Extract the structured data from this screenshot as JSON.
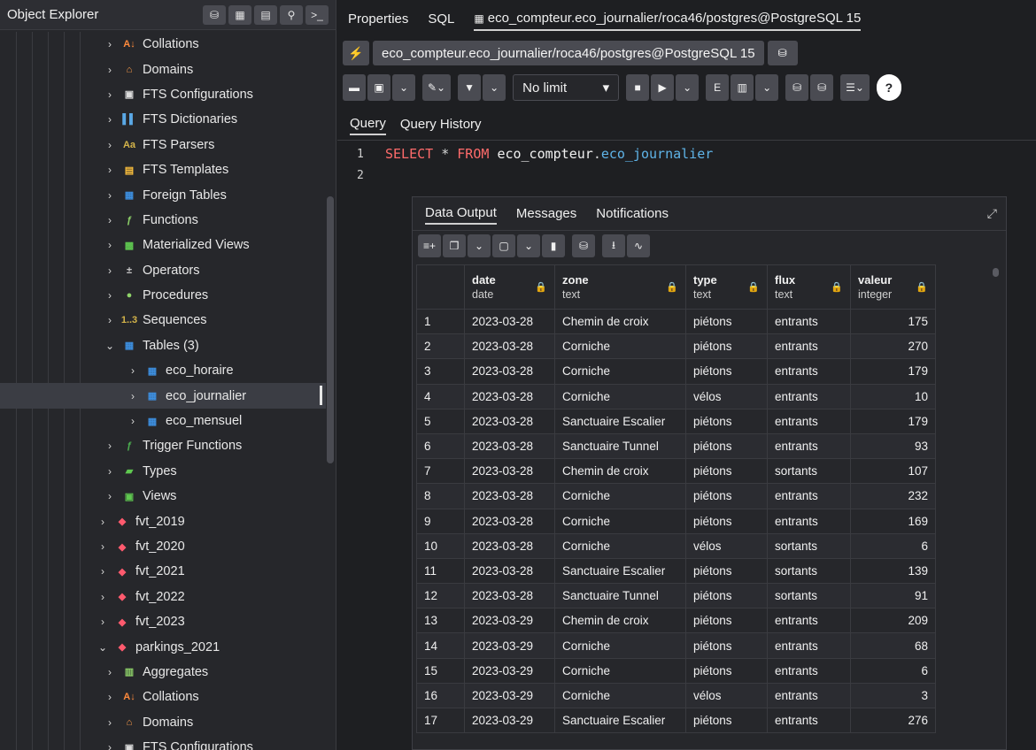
{
  "left_panel": {
    "title": "Object Explorer",
    "header_icons": [
      "database-icon",
      "table-grid-icon",
      "table-view-icon",
      "search-icon",
      "terminal-icon"
    ],
    "tree": [
      {
        "label": "Collations",
        "icon": "collations-icon",
        "indent": 3,
        "chev": "›"
      },
      {
        "label": "Domains",
        "icon": "domains-icon",
        "indent": 3,
        "chev": "›"
      },
      {
        "label": "FTS Configurations",
        "icon": "fts-config-icon",
        "indent": 3,
        "chev": "›"
      },
      {
        "label": "FTS Dictionaries",
        "icon": "fts-dict-icon",
        "indent": 3,
        "chev": "›"
      },
      {
        "label": "FTS Parsers",
        "icon": "fts-parser-icon",
        "indent": 3,
        "chev": "›"
      },
      {
        "label": "FTS Templates",
        "icon": "fts-template-icon",
        "indent": 3,
        "chev": "›"
      },
      {
        "label": "Foreign Tables",
        "icon": "foreign-table-icon",
        "indent": 3,
        "chev": "›"
      },
      {
        "label": "Functions",
        "icon": "function-icon",
        "indent": 3,
        "chev": "›"
      },
      {
        "label": "Materialized Views",
        "icon": "mview-icon",
        "indent": 3,
        "chev": "›"
      },
      {
        "label": "Operators",
        "icon": "operator-icon",
        "indent": 3,
        "chev": "›"
      },
      {
        "label": "Procedures",
        "icon": "procedure-icon",
        "indent": 3,
        "chev": "›"
      },
      {
        "label": "Sequences",
        "icon": "sequence-icon",
        "indent": 3,
        "chev": "›"
      },
      {
        "label": "Tables (3)",
        "icon": "tables-icon",
        "indent": 3,
        "chev": "⌄"
      },
      {
        "label": "eco_horaire",
        "icon": "table-icon",
        "indent": 4,
        "chev": "›"
      },
      {
        "label": "eco_journalier",
        "icon": "table-icon",
        "indent": 4,
        "chev": "›",
        "selected": true
      },
      {
        "label": "eco_mensuel",
        "icon": "table-icon",
        "indent": 4,
        "chev": "›"
      },
      {
        "label": "Trigger Functions",
        "icon": "trigger-function-icon",
        "indent": 3,
        "chev": "›"
      },
      {
        "label": "Types",
        "icon": "type-icon",
        "indent": 3,
        "chev": "›"
      },
      {
        "label": "Views",
        "icon": "view-icon",
        "indent": 3,
        "chev": "›"
      },
      {
        "label": "fvt_2019",
        "icon": "schema-icon",
        "indent": 2,
        "chev": "›"
      },
      {
        "label": "fvt_2020",
        "icon": "schema-icon",
        "indent": 2,
        "chev": "›"
      },
      {
        "label": "fvt_2021",
        "icon": "schema-icon",
        "indent": 2,
        "chev": "›"
      },
      {
        "label": "fvt_2022",
        "icon": "schema-icon",
        "indent": 2,
        "chev": "›"
      },
      {
        "label": "fvt_2023",
        "icon": "schema-icon",
        "indent": 2,
        "chev": "›"
      },
      {
        "label": "parkings_2021",
        "icon": "schema-icon",
        "indent": 2,
        "chev": "⌄"
      },
      {
        "label": "Aggregates",
        "icon": "aggregate-icon",
        "indent": 3,
        "chev": "›"
      },
      {
        "label": "Collations",
        "icon": "collations-icon",
        "indent": 3,
        "chev": "›"
      },
      {
        "label": "Domains",
        "icon": "domains-icon",
        "indent": 3,
        "chev": "›"
      },
      {
        "label": "FTS Configurations",
        "icon": "fts-config-icon",
        "indent": 3,
        "chev": "›"
      }
    ]
  },
  "tabs": [
    "Properties",
    "SQL",
    "eco_compteur.eco_journalier/roca46/postgres@PostgreSQL 15"
  ],
  "connection": "eco_compteur.eco_journalier/roca46/postgres@PostgreSQL 15",
  "toolbar": {
    "limit": "No limit"
  },
  "query_tabs": [
    "Query",
    "Query History"
  ],
  "editor": {
    "line_numbers": [
      "1",
      "2"
    ],
    "kw_select": "SELECT",
    "star": "*",
    "kw_from": "FROM",
    "schema": "eco_compteur",
    "dot": ".",
    "table": "eco_journalier"
  },
  "results": {
    "tabs": [
      "Data Output",
      "Messages",
      "Notifications"
    ],
    "columns": [
      {
        "name": "date",
        "type": "date"
      },
      {
        "name": "zone",
        "type": "text"
      },
      {
        "name": "type",
        "type": "text"
      },
      {
        "name": "flux",
        "type": "text"
      },
      {
        "name": "valeur",
        "type": "integer"
      }
    ],
    "rows": [
      [
        "1",
        "2023-03-28",
        "Chemin de croix",
        "piétons",
        "entrants",
        "175"
      ],
      [
        "2",
        "2023-03-28",
        "Corniche",
        "piétons",
        "entrants",
        "270"
      ],
      [
        "3",
        "2023-03-28",
        "Corniche",
        "piétons",
        "entrants",
        "179"
      ],
      [
        "4",
        "2023-03-28",
        "Corniche",
        "vélos",
        "entrants",
        "10"
      ],
      [
        "5",
        "2023-03-28",
        "Sanctuaire Escalier",
        "piétons",
        "entrants",
        "179"
      ],
      [
        "6",
        "2023-03-28",
        "Sanctuaire Tunnel",
        "piétons",
        "entrants",
        "93"
      ],
      [
        "7",
        "2023-03-28",
        "Chemin de croix",
        "piétons",
        "sortants",
        "107"
      ],
      [
        "8",
        "2023-03-28",
        "Corniche",
        "piétons",
        "entrants",
        "232"
      ],
      [
        "9",
        "2023-03-28",
        "Corniche",
        "piétons",
        "entrants",
        "169"
      ],
      [
        "10",
        "2023-03-28",
        "Corniche",
        "vélos",
        "sortants",
        "6"
      ],
      [
        "11",
        "2023-03-28",
        "Sanctuaire Escalier",
        "piétons",
        "sortants",
        "139"
      ],
      [
        "12",
        "2023-03-28",
        "Sanctuaire Tunnel",
        "piétons",
        "sortants",
        "91"
      ],
      [
        "13",
        "2023-03-29",
        "Chemin de croix",
        "piétons",
        "entrants",
        "209"
      ],
      [
        "14",
        "2023-03-29",
        "Corniche",
        "piétons",
        "entrants",
        "68"
      ],
      [
        "15",
        "2023-03-29",
        "Corniche",
        "piétons",
        "entrants",
        "6"
      ],
      [
        "16",
        "2023-03-29",
        "Corniche",
        "vélos",
        "entrants",
        "3"
      ],
      [
        "17",
        "2023-03-29",
        "Sanctuaire Escalier",
        "piétons",
        "entrants",
        "276"
      ]
    ]
  },
  "colors": {
    "accent_orange": "#ffb43c",
    "accent_green": "#4caf50",
    "accent_blue": "#3d8fe0",
    "schema_red": "#ff5a6e",
    "keyword": "#ff6b6b",
    "identifier_blue": "#5fb4e8"
  }
}
